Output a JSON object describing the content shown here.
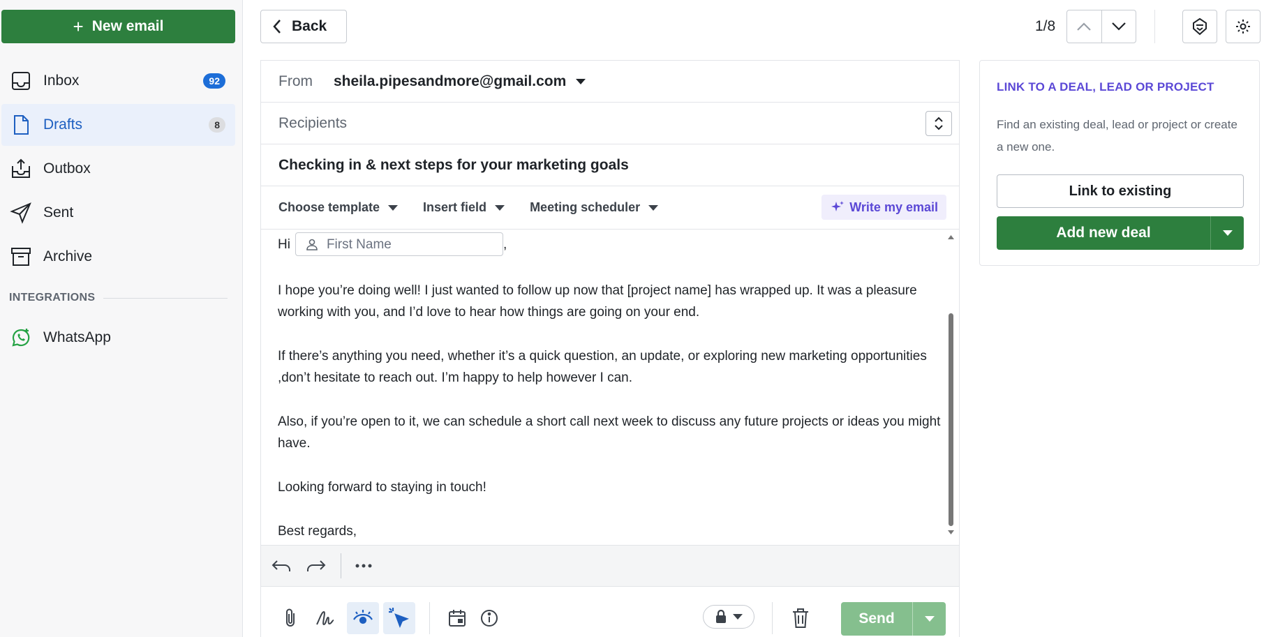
{
  "sidebar": {
    "new_email_label": "New email",
    "items": [
      {
        "label": "Inbox",
        "badge": "92"
      },
      {
        "label": "Drafts",
        "badge": "8"
      },
      {
        "label": "Outbox"
      },
      {
        "label": "Sent"
      },
      {
        "label": "Archive"
      }
    ],
    "integrations_heading": "INTEGRATIONS",
    "whatsapp_label": "WhatsApp"
  },
  "header": {
    "back_label": "Back",
    "page_counter": "1/8"
  },
  "composer": {
    "from_label": "From",
    "from_value": "sheila.pipesandmore@gmail.com",
    "recipients_placeholder": "Recipients",
    "subject": "Checking in & next steps for your marketing goals",
    "toolbar": {
      "template_label": "Choose template",
      "insert_field_label": "Insert field",
      "meeting_label": "Meeting scheduler",
      "write_label": "Write my email"
    },
    "body": {
      "greeting": "Hi",
      "first_name_placeholder": "First Name",
      "greeting_comma": ",",
      "p1": "I hope you’re doing well! I just wanted to follow up now that [project name] has wrapped up. It was a pleasure working with you, and I’d love to hear how things are going on your end.",
      "p2": "If there’s anything you need, whether it’s a quick question, an update, or exploring new marketing opportunities ,don’t hesitate to reach out. I’m happy to help however I can.",
      "p3": "Also, if you’re open to it, we can schedule a short call next week to discuss any future projects or ideas you might have.",
      "p4": "Looking forward to staying in touch!",
      "p5": "Best regards,"
    },
    "send_label": "Send"
  },
  "right_panel": {
    "title": "LINK TO A DEAL, LEAD OR PROJECT",
    "description": "Find an existing deal, lead or project or create a new one.",
    "link_existing_label": "Link to existing",
    "add_deal_label": "Add new deal"
  },
  "colors": {
    "primary_green": "#2d7f3e",
    "accent_purple": "#5b48d6",
    "active_blue": "#1d5fc1",
    "send_disabled_green": "#85bf8e"
  }
}
